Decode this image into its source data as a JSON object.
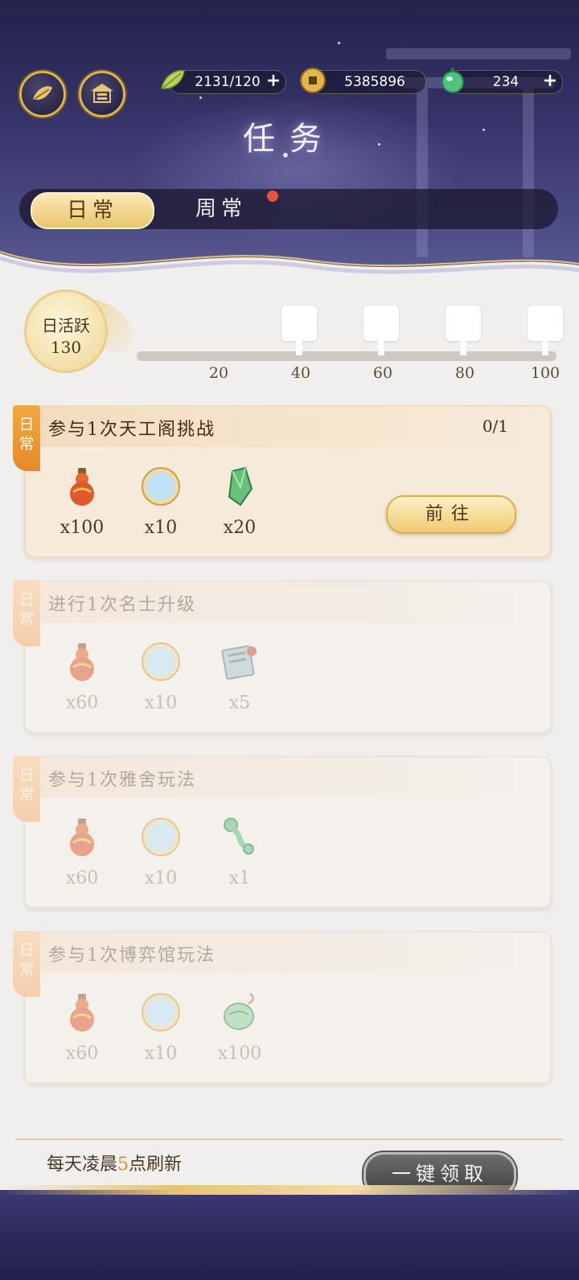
{
  "header": {
    "title": "任务",
    "left_buttons": [
      {
        "icon": "leaf-emblem-icon"
      },
      {
        "icon": "pavilion-icon"
      }
    ],
    "resources": [
      {
        "icon": "green-leaf-icon",
        "value": "2131/120",
        "has_plus": true
      },
      {
        "icon": "copper-coin-icon",
        "value": "5385896",
        "has_plus": false
      },
      {
        "icon": "jade-orb-icon",
        "value": "234",
        "has_plus": true
      }
    ],
    "tabs": [
      {
        "label": "日常",
        "active": true
      },
      {
        "label": "周常",
        "active": false,
        "badge": true
      }
    ]
  },
  "activity": {
    "label": "日活跃",
    "value": "130",
    "milestones": [
      "20",
      "40",
      "60",
      "80",
      "100"
    ]
  },
  "tasks": [
    {
      "tag": "日常",
      "name": "参与1次天工阁挑战",
      "progress": "0/1",
      "action": "前往",
      "dimmed": false,
      "rewards": [
        {
          "icon": "gourd-bottle-icon",
          "count": "x100"
        },
        {
          "icon": "moon-mirror-icon",
          "count": "x10"
        },
        {
          "icon": "green-crystal-icon",
          "count": "x20"
        }
      ]
    },
    {
      "tag": "日常",
      "name": "进行1次名士升级",
      "dimmed": true,
      "rewards": [
        {
          "icon": "gourd-bottle-icon",
          "count": "x60"
        },
        {
          "icon": "moon-mirror-icon",
          "count": "x10"
        },
        {
          "icon": "book-scroll-icon",
          "count": "x5"
        }
      ]
    },
    {
      "tag": "日常",
      "name": "参与1次雅舍玩法",
      "dimmed": true,
      "rewards": [
        {
          "icon": "gourd-bottle-icon",
          "count": "x60"
        },
        {
          "icon": "moon-mirror-icon",
          "count": "x10"
        },
        {
          "icon": "jade-ruyi-icon",
          "count": "x1"
        }
      ]
    },
    {
      "tag": "日常",
      "name": "参与1次博弈馆玩法",
      "dimmed": true,
      "rewards": [
        {
          "icon": "gourd-bottle-icon",
          "count": "x60"
        },
        {
          "icon": "moon-mirror-icon",
          "count": "x10"
        },
        {
          "icon": "jade-pendant-icon",
          "count": "x100"
        }
      ]
    }
  ],
  "footer": {
    "refresh_prefix": "每天凌晨",
    "refresh_hour": "5",
    "refresh_suffix": "点刷新",
    "claim_all": "一键领取"
  }
}
